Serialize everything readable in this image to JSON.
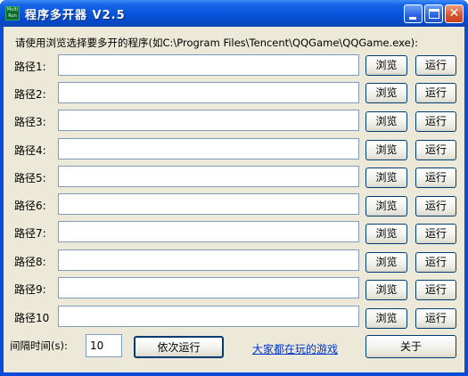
{
  "window": {
    "title": "程序多开器 V2.5",
    "icon_text": "Multi Run"
  },
  "hint": "请使用浏览选择要多开的程序(如C:\\Program Files\\Tencent\\QQGame\\QQGame.exe):",
  "rows": [
    {
      "label": "路径1:",
      "value": "",
      "browse": "浏览",
      "run": "运行"
    },
    {
      "label": "路径2:",
      "value": "",
      "browse": "浏览",
      "run": "运行"
    },
    {
      "label": "路径3:",
      "value": "",
      "browse": "浏览",
      "run": "运行"
    },
    {
      "label": "路径4:",
      "value": "",
      "browse": "浏览",
      "run": "运行"
    },
    {
      "label": "路径5:",
      "value": "",
      "browse": "浏览",
      "run": "运行"
    },
    {
      "label": "路径6:",
      "value": "",
      "browse": "浏览",
      "run": "运行"
    },
    {
      "label": "路径7:",
      "value": "",
      "browse": "浏览",
      "run": "运行"
    },
    {
      "label": "路径8:",
      "value": "",
      "browse": "浏览",
      "run": "运行"
    },
    {
      "label": "路径9:",
      "value": "",
      "browse": "浏览",
      "run": "运行"
    },
    {
      "label": "路径10",
      "value": "",
      "browse": "浏览",
      "run": "运行"
    }
  ],
  "footer": {
    "interval_label": "间隔时间(s):",
    "interval_value": "10",
    "run_sequential": "依次运行",
    "games_link": "大家都在玩的游戏",
    "about": "关于"
  },
  "colors": {
    "titlebar": "#0a55dc",
    "client_bg": "#ece9d8",
    "link": "#0033cc",
    "close_button": "#d8532b"
  }
}
